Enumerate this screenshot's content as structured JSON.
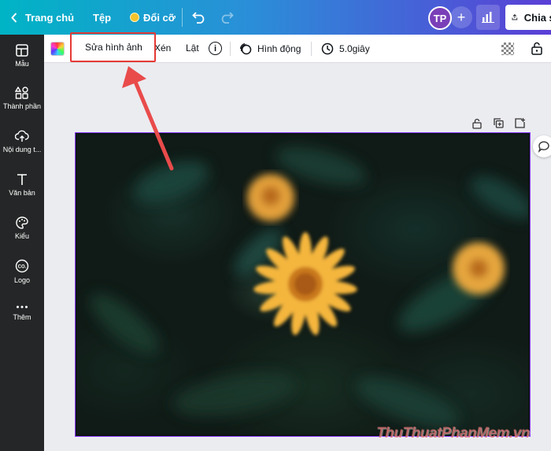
{
  "topbar": {
    "back_label": "Trang chủ",
    "file_label": "Tệp",
    "resize_label": "Đổi cỡ",
    "avatar_initials": "TP",
    "add_label": "+",
    "share_label": "Chia sẻ"
  },
  "sidebar": {
    "items": [
      {
        "label": "Mẫu",
        "icon": "template-icon"
      },
      {
        "label": "Thành phần",
        "icon": "elements-icon"
      },
      {
        "label": "Nội dung t...",
        "icon": "upload-icon"
      },
      {
        "label": "Văn bản",
        "icon": "text-icon"
      },
      {
        "label": "Kiểu",
        "icon": "palette-icon"
      },
      {
        "label": "Logo",
        "icon": "logo-icon"
      },
      {
        "label": "Thêm",
        "icon": "more-icon"
      }
    ]
  },
  "toolbar": {
    "edit_image_label": "Sửa hình ảnh",
    "crop_label": "Xén",
    "flip_label": "Lật",
    "info_label": "i",
    "animate_label": "Hình động",
    "duration_label": "5.0giây"
  },
  "watermark": "ThuThuatPhanMem.vn",
  "colors": {
    "accent": "#8b3dff",
    "highlight": "#e53935",
    "arrow": "#e94b4b",
    "sidebar": "#252627",
    "flower": "#f4b63c"
  }
}
